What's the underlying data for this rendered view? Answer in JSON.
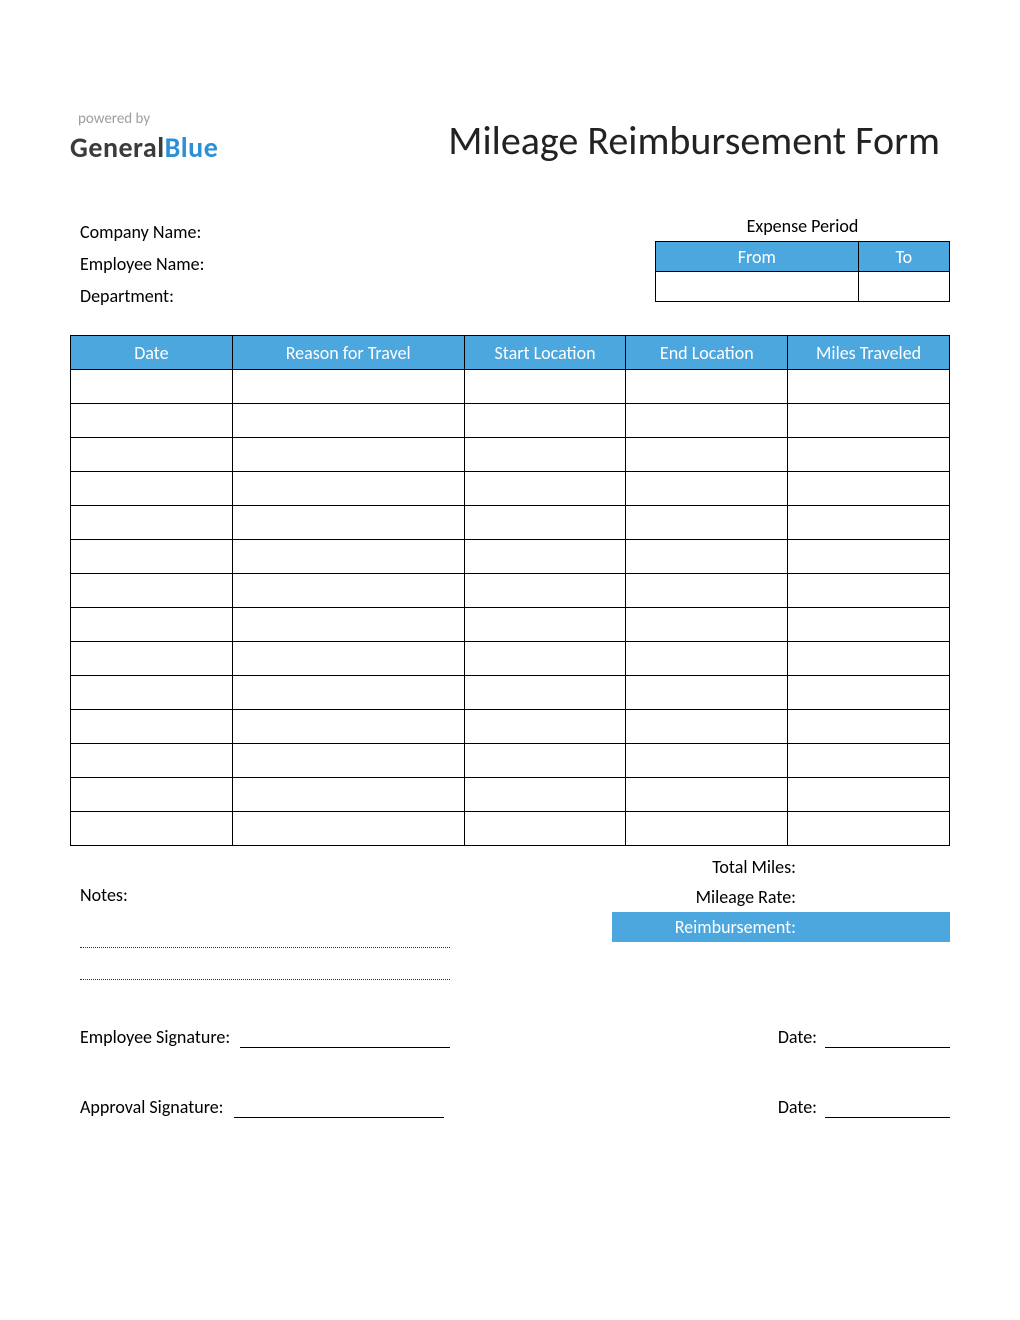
{
  "header": {
    "powered_by": "powered by",
    "logo_part1": "General",
    "logo_part2": "Blue",
    "title": "Mileage Reimbursement Form"
  },
  "info": {
    "company_label": "Company Name:",
    "employee_label": "Employee Name:",
    "department_label": "Department:"
  },
  "period": {
    "title": "Expense Period",
    "from": "From",
    "to": "To",
    "from_value": "",
    "to_value": ""
  },
  "table": {
    "headers": {
      "date": "Date",
      "reason": "Reason for Travel",
      "start": "Start Location",
      "end": "End Location",
      "miles": "Miles Traveled"
    },
    "row_count": 14
  },
  "totals": {
    "total_miles_label": "Total Miles:",
    "mileage_rate_label": "Mileage Rate:",
    "reimbursement_label": "Reimbursement:",
    "total_miles_value": "",
    "mileage_rate_value": "",
    "reimbursement_value": ""
  },
  "notes": {
    "label": "Notes:"
  },
  "signatures": {
    "employee_label": "Employee Signature:",
    "approval_label": "Approval Signature:",
    "date_label": "Date:"
  }
}
